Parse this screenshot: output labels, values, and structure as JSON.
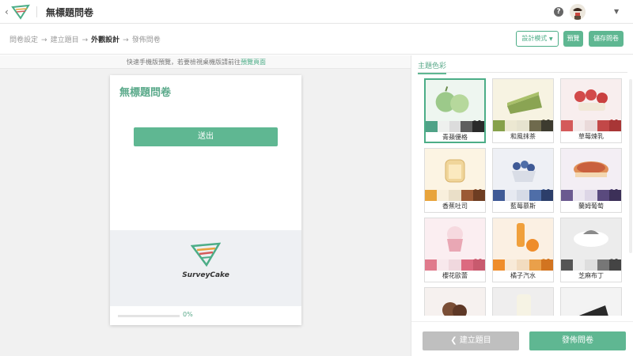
{
  "header": {
    "title": "無標題問卷"
  },
  "steps": {
    "items": [
      "問卷設定",
      "建立題目",
      "外觀設計",
      "發佈問卷"
    ],
    "active_index": 2
  },
  "toolbar": {
    "design_mode_label": "設計模式",
    "preview_label": "預覽",
    "save_label": "儲存問卷"
  },
  "preview": {
    "hint_text": "快速手機版預覽，若要檢視桌機版請前往",
    "hint_link": "預覽頁面",
    "survey_title": "無標題問卷",
    "submit_label": "送出",
    "brand_name": "SurveyCake",
    "progress_label": "0%",
    "progress_value": 0
  },
  "theme_panel": {
    "tab_label": "主題色彩",
    "themes": [
      {
        "name": "青蘋優格",
        "selected": true,
        "bg": "#eef6f0",
        "illus": "apple",
        "colors": [
          "#4fa287",
          "#eef0ee",
          "#dcdcdc",
          "#5e5e5e",
          "#2a2a2a"
        ]
      },
      {
        "name": "和風抹茶",
        "selected": false,
        "bg": "#f7f3e2",
        "illus": "cake",
        "colors": [
          "#86a14b",
          "#ece8d2",
          "#e6e3cf",
          "#6f6a4d",
          "#3d3b2f"
        ]
      },
      {
        "name": "草莓煉乳",
        "selected": false,
        "bg": "#f8eeee",
        "illus": "strawberry",
        "colors": [
          "#d45a5a",
          "#f4eaea",
          "#eadada",
          "#c24848",
          "#a83636"
        ]
      },
      {
        "name": "香蕉吐司",
        "selected": false,
        "bg": "#fcf4e3",
        "illus": "toast",
        "colors": [
          "#e8a43c",
          "#f8efdc",
          "#eadfc8",
          "#9b5a35",
          "#6e3d22"
        ]
      },
      {
        "name": "藍莓慕斯",
        "selected": false,
        "bg": "#eef0f5",
        "illus": "blueberry",
        "colors": [
          "#3f5a96",
          "#e6e9f1",
          "#d6dbe6",
          "#4f6ea8",
          "#2c3e6a"
        ]
      },
      {
        "name": "蘭姆葡萄",
        "selected": false,
        "bg": "#f3eef4",
        "illus": "pie",
        "colors": [
          "#6b5a90",
          "#ece7f0",
          "#ddd6e6",
          "#5a4a7e",
          "#3c3058"
        ]
      },
      {
        "name": "櫻花歐蕾",
        "selected": false,
        "bg": "#fbeef1",
        "illus": "cupcake",
        "colors": [
          "#e07a8c",
          "#f8e8ec",
          "#f0d8de",
          "#dc6a80",
          "#c85a6e"
        ]
      },
      {
        "name": "橘子汽水",
        "selected": false,
        "bg": "#fbf0e3",
        "illus": "orange",
        "colors": [
          "#ef8d2b",
          "#f8ead8",
          "#f2dcc0",
          "#eaa04a",
          "#d27420"
        ]
      },
      {
        "name": "芝麻布丁",
        "selected": false,
        "bg": "#ececec",
        "illus": "pudding",
        "colors": [
          "#555555",
          "#ececec",
          "#dedede",
          "#777777",
          "#444444"
        ]
      },
      {
        "name": "",
        "selected": false,
        "bg": "#f6f1ef",
        "illus": "choco",
        "colors": []
      },
      {
        "name": "",
        "selected": false,
        "bg": "#efeeee",
        "illus": "milk",
        "colors": []
      },
      {
        "name": "",
        "selected": false,
        "bg": "#f3f3f3",
        "illus": "darkcake",
        "colors": []
      }
    ]
  },
  "footer": {
    "prev_label": "❮ 建立題目",
    "publish_label": "發佈問卷"
  },
  "icons": {
    "back": "chevron-left-icon",
    "help": "help-icon",
    "caret": "caret-down-icon"
  }
}
